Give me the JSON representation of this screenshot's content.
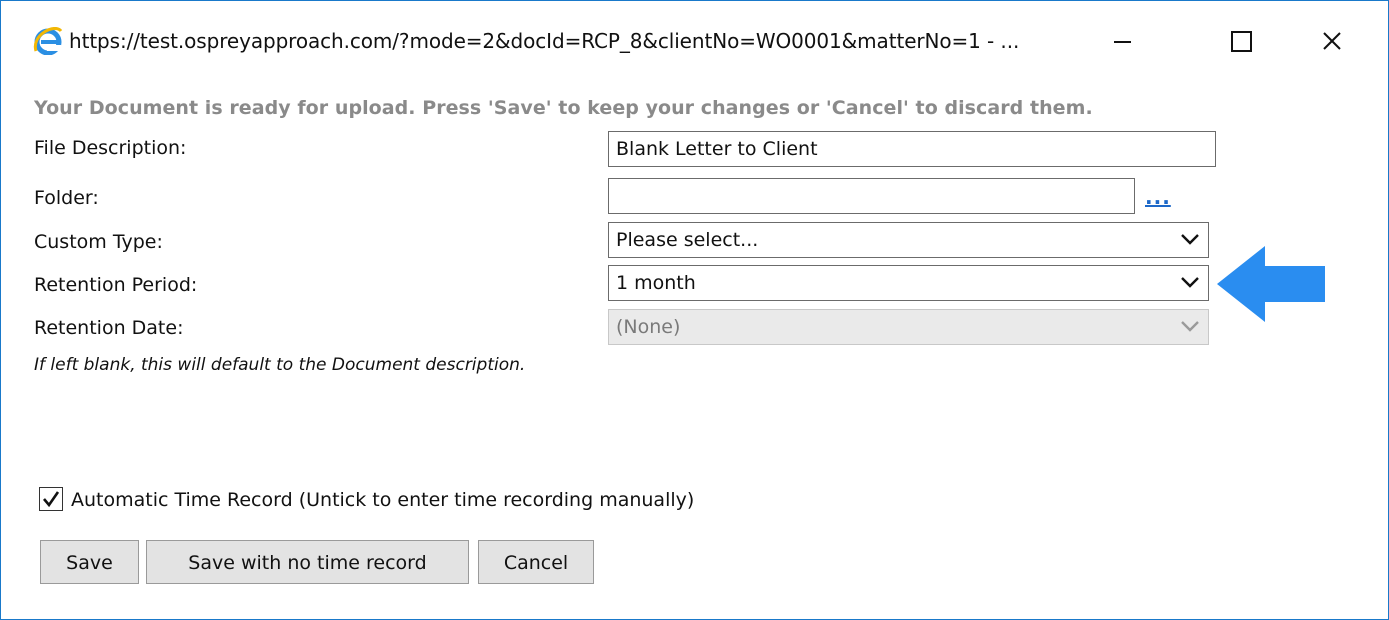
{
  "window": {
    "title": "https://test.ospreyapproach.com/?mode=2&docId=RCP_8&clientNo=WO0001&matterNo=1 - ..."
  },
  "form": {
    "notice": "Your Document is ready for upload. Press 'Save' to keep your changes or 'Cancel' to discard them.",
    "file_description": {
      "label": "File Description:",
      "value": "Blank Letter to Client"
    },
    "folder": {
      "label": "Folder:",
      "value": "",
      "browse": "..."
    },
    "custom_type": {
      "label": "Custom Type:",
      "selected": "Please select..."
    },
    "retention_period": {
      "label": "Retention Period:",
      "selected": "1 month"
    },
    "retention_date": {
      "label": "Retention Date:",
      "selected": "(None)"
    },
    "hint": "If left blank, this will default to the Document description."
  },
  "time_record": {
    "label": "Automatic Time Record (Untick to enter time recording manually)",
    "checked": true
  },
  "buttons": {
    "save": "Save",
    "save_no_time": "Save with no time record",
    "cancel": "Cancel"
  },
  "colors": {
    "window_border": "#1979ca",
    "notice_text": "#8a8a8a",
    "link": "#1d68c8",
    "arrow": "#2a8df0"
  }
}
